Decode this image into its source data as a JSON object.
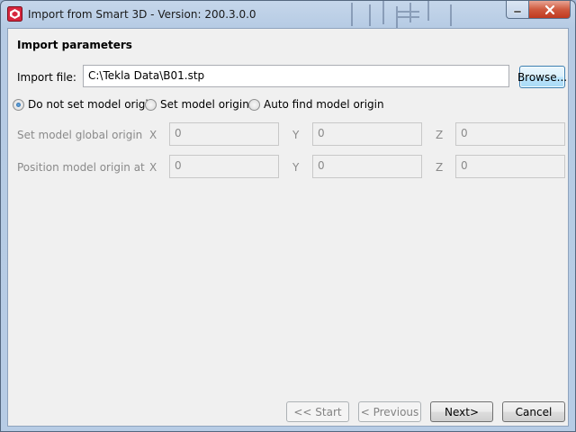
{
  "window": {
    "title": "Import from Smart 3D - Version: 200.3.0.0"
  },
  "section": {
    "title": "Import parameters"
  },
  "import_file": {
    "label": "Import file:",
    "value": "C:\\Tekla Data\\B01.stp",
    "browse_label": "Browse..."
  },
  "origin_options": [
    {
      "label": "Do not set model origin",
      "checked": true
    },
    {
      "label": "Set model origin",
      "checked": false
    },
    {
      "label": "Auto find model origin",
      "checked": false
    }
  ],
  "global_origin": {
    "label": "Set model global origin",
    "x_label": "X",
    "x_value": "0",
    "y_label": "Y",
    "y_value": "0",
    "z_label": "Z",
    "z_value": "0"
  },
  "position_origin": {
    "label": "Position model origin at",
    "x_label": "X",
    "x_value": "0",
    "y_label": "Y",
    "y_value": "0",
    "z_label": "Z",
    "z_value": "0"
  },
  "footer": {
    "start_label": "<< Start",
    "previous_label": "< Previous",
    "next_label": "Next>",
    "cancel_label": "Cancel"
  },
  "colors": {
    "titlebar": "#b9cde5",
    "close_button": "#c7432a",
    "focus_accent": "#3c7fb1",
    "disabled_text": "#8a8a8a"
  },
  "icons": {
    "app": "tekla-app-icon",
    "minimize": "minimize-icon",
    "close": "close-icon"
  }
}
